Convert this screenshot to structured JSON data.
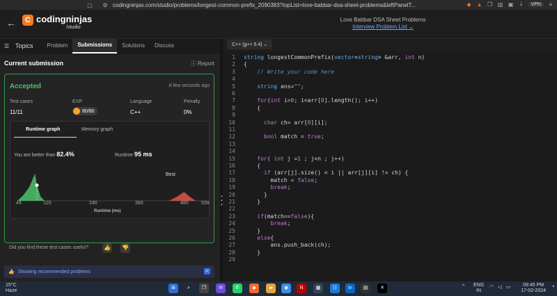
{
  "browser": {
    "url": "codingninjas.com/studio/problems/longest-common-prefix_2090383?topList=love-babbar-dsa-sheet-problems&leftPanelT...",
    "vpn_label": "VPN"
  },
  "header": {
    "brand": "codingninjas",
    "brand_sub": "/studio",
    "sheet_title": "Love Babbar DSA Sheet Problems",
    "sheet_link": "Interview Problem List"
  },
  "tabs": [
    "Topics",
    "Problem",
    "Submissions",
    "Solutions",
    "Discuss"
  ],
  "submission": {
    "title": "Current submission",
    "report_label": "Report",
    "status": "Accepted",
    "time_ago": "A few seconds ago",
    "stats": [
      {
        "label": "Test cases",
        "value": "11/11"
      },
      {
        "label": "EXP",
        "value": "80/80"
      },
      {
        "label": "Language",
        "value": "C++"
      },
      {
        "label": "Penalty",
        "value": "0%"
      }
    ],
    "graph_tabs": [
      "Runtime graph",
      "Memory graph"
    ],
    "better_label": "You are better than",
    "better_value": "82.4%",
    "runtime_label": "Runtime",
    "runtime_value": "95 ms",
    "best_label": "Best",
    "x_ticks": [
      "44",
      "120",
      "240",
      "360",
      "480",
      "539"
    ],
    "x_title": "Runtime (ms)",
    "feedback_q": "Did you find these test cases useful?",
    "recommended": "Showing recommended problems"
  },
  "chart_data": {
    "type": "area",
    "xlabel": "Runtime (ms)",
    "x_ticks": [
      44,
      120,
      240,
      360,
      480,
      539
    ],
    "xlim": [
      44,
      539
    ],
    "series": [
      {
        "color": "#4cc26e",
        "x": [
          44,
          60,
          75,
          90,
          95,
          105,
          115
        ],
        "y": [
          0,
          6,
          14,
          28,
          16,
          4,
          0
        ]
      },
      {
        "color": "#e0564a",
        "x": [
          440,
          460,
          480,
          495,
          510
        ],
        "y": [
          0,
          4,
          9,
          4,
          0
        ]
      }
    ],
    "marker_x": 95,
    "legend": "top-right"
  },
  "editor": {
    "language": "C++ (g++ 5.4)",
    "lines": [
      "string longestCommonPrefix(vector<string> &arr, int n)",
      "{",
      "    // Write your code here",
      "",
      "    string ans=\"\";",
      "",
      "    for(int i=0; i<arr[0].length(); i++)",
      "    {",
      "",
      "      char ch= arr[0][i];",
      "",
      "      bool match = true;",
      "",
      "",
      "    for( int j =1 ; j<n ; j++)",
      "    {",
      "      if (arr[j].size() < i || arr[j][i] != ch) {",
      "        match = false;",
      "        break;",
      "      }",
      "    }",
      "",
      "    if(match==false){",
      "        break;",
      "    }",
      "    else{",
      "        ans.push_back(ch);",
      "    }",
      ""
    ]
  },
  "taskbar": {
    "temp": "15°C",
    "weather": "Haze",
    "lang": "ENG",
    "region": "IN",
    "time": "09:45 PM",
    "date": "17-02-2024"
  },
  "colors": {
    "accent_green": "#4cc26e",
    "brand_orange": "#f47b20",
    "link_blue": "#6fa8ff"
  }
}
